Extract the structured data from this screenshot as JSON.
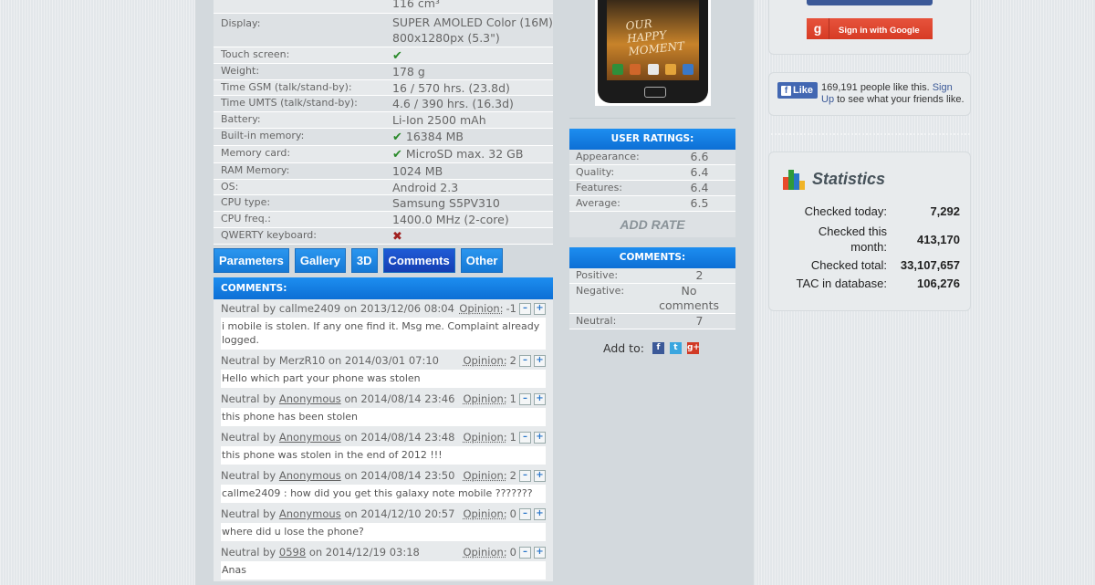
{
  "specs": [
    {
      "label": "",
      "value": "116 cm³"
    },
    {
      "label": "Display:",
      "value": "SUPER AMOLED Color (16M) 800x1280px (5.3\")"
    },
    {
      "label": "Touch screen:",
      "value": "",
      "icon": "check-icon"
    },
    {
      "label": "Weight:",
      "value": "178 g"
    },
    {
      "label": "Time GSM (talk/stand-by):",
      "value": "16 / 570 hrs. (23.8d)"
    },
    {
      "label": "Time UMTS (talk/stand-by):",
      "value": "4.6 / 390 hrs. (16.3d)"
    },
    {
      "label": "Battery:",
      "value": "Li-Ion 2500 mAh"
    },
    {
      "label": "Built-in memory:",
      "value": "16384 MB",
      "icon": "check-icon"
    },
    {
      "label": "Memory card:",
      "value": "MicroSD max. 32 GB",
      "icon": "check-icon"
    },
    {
      "label": "RAM Memory:",
      "value": "1024 MB"
    },
    {
      "label": "OS:",
      "value": "Android 2.3"
    },
    {
      "label": "CPU type:",
      "value": "Samsung S5PV310"
    },
    {
      "label": "CPU freq.:",
      "value": "1400.0 MHz (2-core)"
    },
    {
      "label": "QWERTY keyboard:",
      "value": "",
      "icon": "cross-icon"
    }
  ],
  "tabs": [
    "Parameters",
    "Gallery",
    "3D",
    "Comments",
    "Other"
  ],
  "comments_header": "COMMENTS:",
  "comments": [
    {
      "prefix": "Neutral by",
      "author": "callme2409",
      "date": "on 2013/12/06 08:04",
      "opinion": "-1",
      "text": "i mobile is stolen. If any one find it. Msg me. Complaint already logged."
    },
    {
      "prefix": "Neutral by",
      "author": "MerzR10",
      "date": "on 2014/03/01 07:10",
      "opinion": "2",
      "text": "Hello which part your phone was stolen"
    },
    {
      "prefix": "Neutral by",
      "author": "Anonymous",
      "date": "on 2014/08/14 23:46",
      "opinion": "1",
      "text": "this phone has been stolen"
    },
    {
      "prefix": "Neutral by",
      "author": "Anonymous",
      "date": "on 2014/08/14 23:48",
      "opinion": "1",
      "text": "this phone was stolen in the end of 2012 !!!"
    },
    {
      "prefix": "Neutral by",
      "author": "Anonymous",
      "date": "on 2014/08/14 23:50",
      "opinion": "2",
      "text": "callme2409 : how did you get this galaxy note mobile ???????"
    },
    {
      "prefix": "Neutral by",
      "author": "Anonymous",
      "date": "on 2014/12/10 20:57",
      "opinion": "0",
      "text": "where did u lose the phone?"
    },
    {
      "prefix": "Neutral by",
      "author": "0598",
      "date": "on 2014/12/19 03:18",
      "opinion": "0",
      "text": "Anas"
    }
  ],
  "opinion_label": "Opinion:",
  "phone_screen_text": "OUR HAPPY MOMENT",
  "user_ratings": {
    "title": "USER RATINGS:",
    "rows": [
      {
        "label": "Appearance:",
        "value": "6.6"
      },
      {
        "label": "Quality:",
        "value": "6.4"
      },
      {
        "label": "Features:",
        "value": "6.4"
      },
      {
        "label": "Average:",
        "value": "6.5"
      }
    ],
    "add_rate": "ADD RATE"
  },
  "comments_summary": {
    "title": "COMMENTS:",
    "rows": [
      {
        "label": "Positive:",
        "value": "2"
      },
      {
        "label": "Negative:",
        "value": "No comments"
      },
      {
        "label": "Neutral:",
        "value": "7"
      }
    ]
  },
  "add_to": "Add to:",
  "google_signin": "Sign in with Google",
  "facebook": {
    "like_label": "Like",
    "text": "169,191 people like this.",
    "signup": "Sign Up",
    "text2": "to see what your friends like."
  },
  "statistics": {
    "title": "Statistics",
    "rows": [
      {
        "label": "Checked today:",
        "value": "7,292"
      },
      {
        "label": "Checked this month:",
        "value": "413,170"
      },
      {
        "label": "Checked total:",
        "value": "33,107,657"
      },
      {
        "label": "TAC in database:",
        "value": "106,276"
      }
    ]
  },
  "colors": {
    "accent": "#1679d6",
    "header_blue": "#0d6fd5",
    "google_red": "#d73b24",
    "facebook_blue": "#3b5998"
  }
}
